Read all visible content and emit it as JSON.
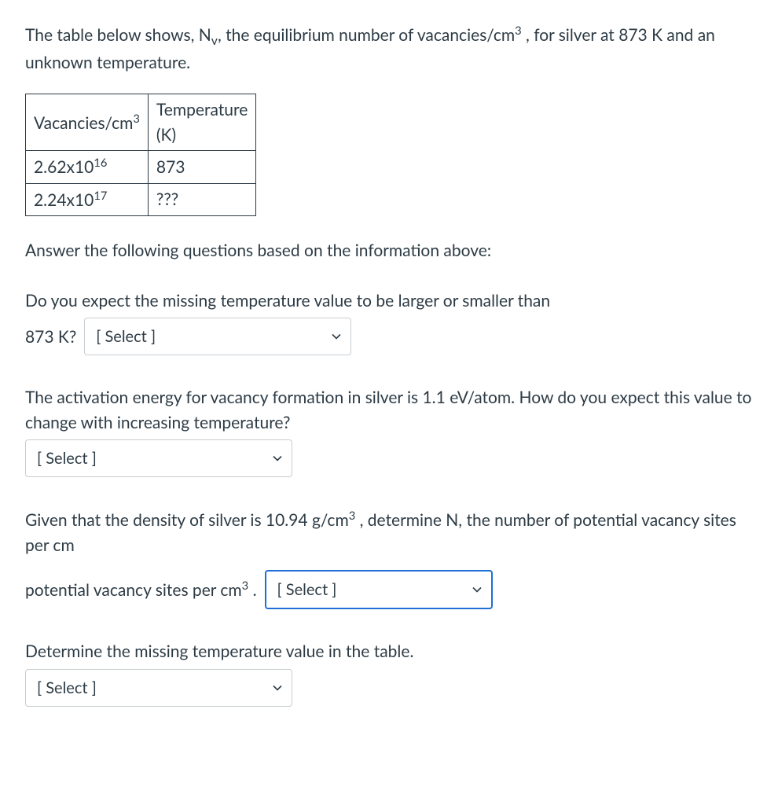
{
  "intro": {
    "text_before": "The table below shows, N",
    "sub1": "v",
    "text_mid": ", the equilibrium number of vacancies/cm",
    "sup1": "3",
    "text_after": " , for silver at 873 K and an unknown temperature."
  },
  "table": {
    "header": {
      "col1_pre": "Vacancies/cm",
      "col1_sup": "3",
      "col2_line1": "Temperature",
      "col2_line2": "(K)"
    },
    "row1": {
      "val_pre": "2.62x10",
      "val_sup": "16",
      "temp": "873"
    },
    "row2": {
      "val_pre": "2.24x10",
      "val_sup": "17",
      "temp": "???"
    }
  },
  "q_intro": "Answer the following questions based on the information above:",
  "q1": {
    "line1": "Do you expect the missing temperature value to be larger or smaller than",
    "line2_prefix": "873 K?",
    "select": "[ Select ]"
  },
  "q2": {
    "text": "The activation energy for vacancy formation in silver is 1.1 eV/atom. How do you expect this value to change with increasing temperature?",
    "select": "[ Select ]"
  },
  "q3": {
    "pre": "Given that the density of silver is 10.94 g/cm",
    "sup1": "3",
    "mid": " , determine N, the number of potential vacancy sites per cm",
    "sup2": "3",
    "after": " .",
    "select": "[ Select ]"
  },
  "q4": {
    "text": "Determine the missing temperature value in the table.",
    "select": "[ Select ]"
  }
}
